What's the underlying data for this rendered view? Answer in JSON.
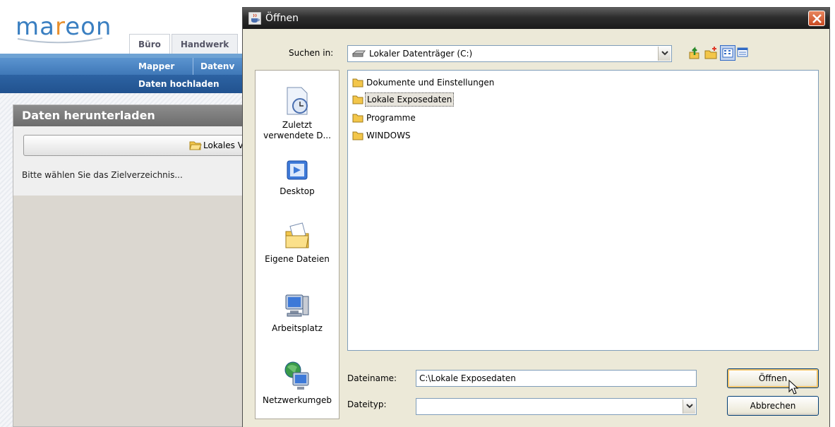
{
  "app": {
    "logo": {
      "text_a": "ma",
      "text_b": "r",
      "text_c": "eon"
    },
    "tabs": [
      {
        "label": "Büro"
      },
      {
        "label": "Handwerk"
      }
    ],
    "nav_row1": [
      {
        "label": "Mapper"
      },
      {
        "label": "Datenv"
      }
    ],
    "nav_row2": [
      {
        "label": "Daten hochladen"
      }
    ],
    "panel": {
      "title": "Daten herunterladen",
      "local_button_label": "Lokales Ve",
      "message": "Bitte wählen Sie das Zielverzeichnis..."
    }
  },
  "dialog": {
    "title": "Öffnen",
    "look_in_label": "Suchen in:",
    "look_in_value": "Lokaler Datenträger (C:)",
    "places": [
      {
        "label_line1": "Zuletzt",
        "label_line2": "verwendete D...",
        "icon": "recent-documents-icon"
      },
      {
        "label_line1": "Desktop",
        "label_line2": "",
        "icon": "desktop-icon"
      },
      {
        "label_line1": "Eigene Dateien",
        "label_line2": "",
        "icon": "my-documents-icon"
      },
      {
        "label_line1": "Arbeitsplatz",
        "label_line2": "",
        "icon": "my-computer-icon"
      },
      {
        "label_line1": "Netzwerkumgeb",
        "label_line2": "",
        "icon": "network-icon"
      }
    ],
    "files": [
      {
        "name": "Dokumente und Einstellungen",
        "selected": false
      },
      {
        "name": "Lokale Exposedaten",
        "selected": true
      },
      {
        "name": "Programme",
        "selected": false
      },
      {
        "name": "WINDOWS",
        "selected": false
      }
    ],
    "file_name_label": "Dateiname:",
    "file_name_value": "C:\\Lokale Exposedaten",
    "file_type_label": "Dateityp:",
    "file_type_value": "",
    "open_button": "Öffnen",
    "cancel_button": "Abbrechen"
  },
  "colors": {
    "nav_blue": "#3f78b8",
    "close_red": "#c94a22",
    "folder_yellow": "#f3c64a"
  }
}
